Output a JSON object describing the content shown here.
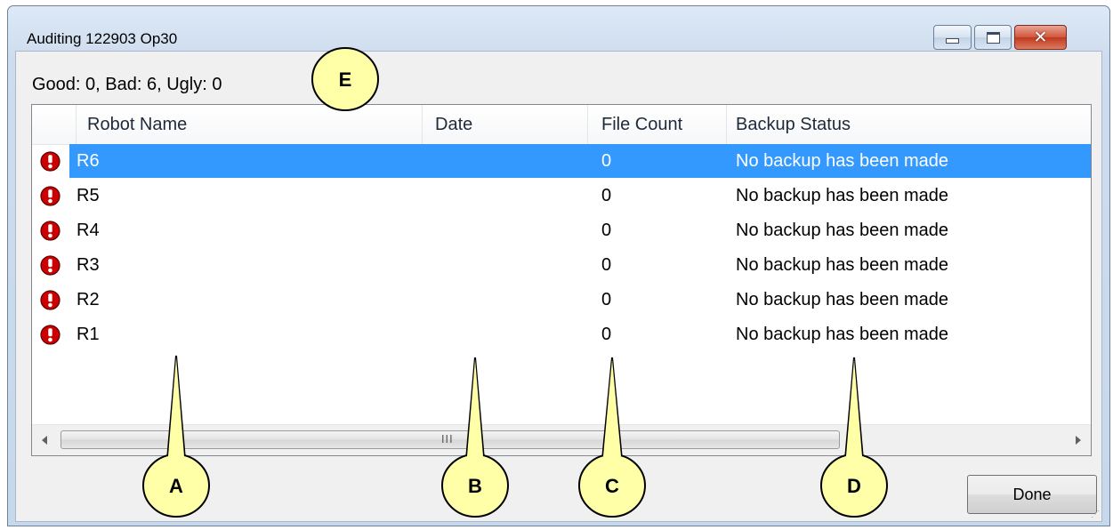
{
  "window": {
    "title": "Auditing 122903 Op30",
    "controls": {
      "minimize": "minimize-icon",
      "maximize": "maximize-icon",
      "close": "close-icon"
    }
  },
  "summary": "Good: 0, Bad: 6, Ugly: 0",
  "columns": [
    "Robot Name",
    "Date",
    "File Count",
    "Backup Status"
  ],
  "rows": [
    {
      "name": "R6",
      "date": "",
      "file_count": "0",
      "status": "No backup has been made",
      "selected": true
    },
    {
      "name": "R5",
      "date": "",
      "file_count": "0",
      "status": "No backup has been made",
      "selected": false
    },
    {
      "name": "R4",
      "date": "",
      "file_count": "0",
      "status": "No backup has been made",
      "selected": false
    },
    {
      "name": "R3",
      "date": "",
      "file_count": "0",
      "status": "No backup has been made",
      "selected": false
    },
    {
      "name": "R2",
      "date": "",
      "file_count": "0",
      "status": "No backup has been made",
      "selected": false
    },
    {
      "name": "R1",
      "date": "",
      "file_count": "0",
      "status": "No backup has been made",
      "selected": false
    }
  ],
  "row_icon": "error-exclamation-icon",
  "scrollbar": {
    "grip": "III"
  },
  "done_button": "Done",
  "callouts": {
    "a": "A",
    "b": "B",
    "c": "C",
    "d": "D",
    "e": "E"
  },
  "colors": {
    "selection": "#3399ff",
    "error_icon": "#cc0000",
    "callout_fill": "#ffffa8"
  }
}
